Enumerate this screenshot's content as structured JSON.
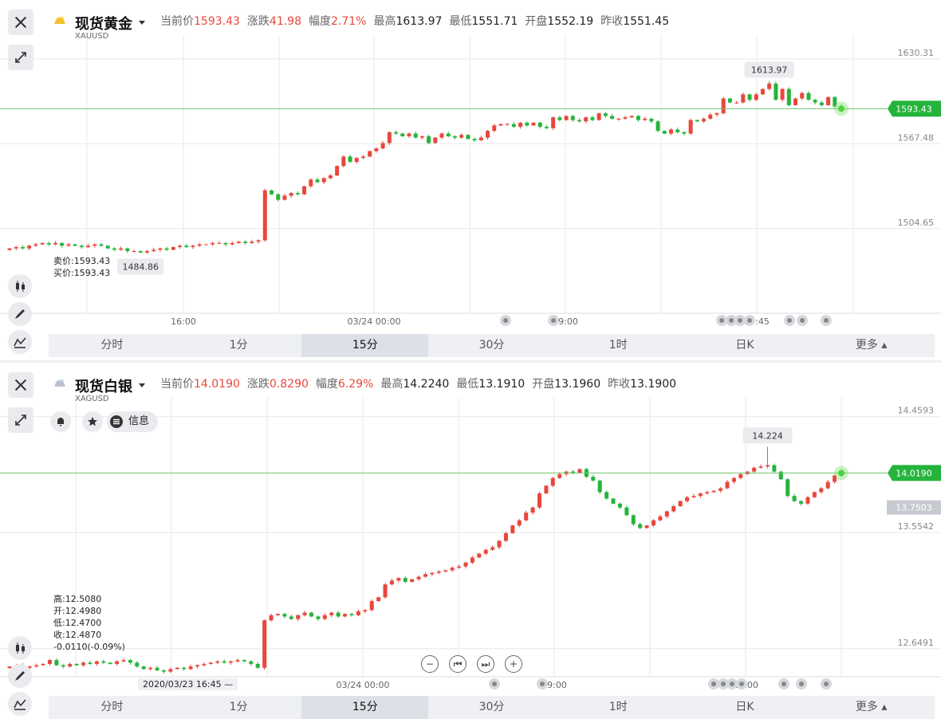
{
  "panels": [
    {
      "name": "现货黄金",
      "code": "XAUUSD",
      "quotes": [
        {
          "label": "当前价",
          "value": "1593.43",
          "up": true
        },
        {
          "label": "涨跌",
          "value": "41.98",
          "up": true
        },
        {
          "label": "幅度",
          "value": "2.71%",
          "up": true
        },
        {
          "label": "最高",
          "value": "1613.97",
          "up": false
        },
        {
          "label": "最低",
          "value": "1551.71",
          "up": false
        },
        {
          "label": "开盘",
          "value": "1552.19",
          "up": false
        },
        {
          "label": "昨收",
          "value": "1551.45",
          "up": false
        }
      ],
      "info": [
        "卖价:1593.43",
        "买价:1593.43"
      ]
    },
    {
      "name": "现货白银",
      "code": "XAGUSD",
      "quotes": [
        {
          "label": "当前价",
          "value": "14.0190",
          "up": true
        },
        {
          "label": "涨跌",
          "value": "0.8290",
          "up": true
        },
        {
          "label": "幅度",
          "value": "6.29%",
          "up": true
        },
        {
          "label": "最高",
          "value": "14.2240",
          "up": false
        },
        {
          "label": "最低",
          "value": "13.1910",
          "up": false
        },
        {
          "label": "开盘",
          "value": "13.1960",
          "up": false
        },
        {
          "label": "昨收",
          "value": "13.1900",
          "up": false
        }
      ],
      "info": [
        "高:12.5080",
        "开:12.4980",
        "低:12.4700",
        "收:12.4870",
        "-0.0110(-0.09%)"
      ],
      "buttons": {
        "info": "信息"
      },
      "crosshair_time": "2020/03/23 16:45"
    }
  ],
  "tabs": [
    "分时",
    "1分",
    "15分",
    "30分",
    "1时",
    "日K",
    "更多"
  ],
  "active_tab": "15分",
  "colors": {
    "up": "#e8473c",
    "down": "#25b43b",
    "price_line": "#6bc46d",
    "grid": "#e8e8e8"
  },
  "chart_data": [
    {
      "type": "candlestick",
      "symbol": "XAUUSD",
      "interval": "15分",
      "ylim": [
        1442,
        1642
      ],
      "y_ticks": [
        "1630.31",
        "1567.48",
        "1504.65"
      ],
      "x_ticks": [
        "16:00",
        "03/24 00:00",
        "09:00",
        "17:45"
      ],
      "last_price": "1593.43",
      "high_label": "1613.97",
      "low_label": "1484.86",
      "close": [
        1490,
        1491,
        1490,
        1492,
        1493,
        1494,
        1493,
        1494,
        1492,
        1493,
        1492,
        1491,
        1492,
        1493,
        1492,
        1490,
        1489,
        1490,
        1488,
        1488,
        1487,
        1488,
        1489,
        1490,
        1489,
        1491,
        1492,
        1491,
        1492,
        1493,
        1493,
        1494,
        1494,
        1493,
        1494,
        1495,
        1494,
        1495,
        1496,
        1533,
        1530,
        1526,
        1529,
        1531,
        1530,
        1536,
        1541,
        1539,
        1542,
        1544,
        1551,
        1558,
        1554,
        1557,
        1558,
        1562,
        1564,
        1568,
        1576,
        1575,
        1573,
        1575,
        1572,
        1573,
        1568,
        1572,
        1575,
        1573,
        1572,
        1574,
        1571,
        1570,
        1572,
        1577,
        1581,
        1582,
        1582,
        1580,
        1583,
        1581,
        1583,
        1580,
        1579,
        1587,
        1585,
        1588,
        1585,
        1584,
        1587,
        1585,
        1590,
        1588,
        1586,
        1586,
        1587,
        1588,
        1585,
        1586,
        1584,
        1577,
        1575,
        1578,
        1576,
        1575,
        1585,
        1584,
        1586,
        1589,
        1590,
        1601,
        1598,
        1598,
        1604,
        1600,
        1604,
        1608,
        1612,
        1600,
        1608,
        1596,
        1601,
        1605,
        1600,
        1598,
        1596,
        1602,
        1595,
        1593.43
      ]
    },
    {
      "type": "candlestick",
      "symbol": "XAGUSD",
      "interval": "15分",
      "ylim": [
        12.43,
        14.55
      ],
      "y_ticks": [
        "14.4593",
        "13.5542",
        "12.6491"
      ],
      "x_ticks": [
        "03/24 00:00",
        "09:00",
        "17:00"
      ],
      "last_price": "14.0190",
      "current_level": "13.7503",
      "high_label": "14.224",
      "close": [
        12.51,
        12.52,
        12.5,
        12.51,
        12.52,
        12.53,
        12.56,
        12.52,
        12.51,
        12.53,
        12.52,
        12.54,
        12.53,
        12.55,
        12.54,
        12.53,
        12.55,
        12.56,
        12.54,
        12.51,
        12.49,
        12.5,
        12.48,
        12.47,
        12.49,
        12.5,
        12.49,
        12.51,
        12.52,
        12.53,
        12.54,
        12.55,
        12.54,
        12.55,
        12.56,
        12.55,
        12.53,
        12.5,
        12.87,
        12.91,
        12.92,
        12.9,
        12.88,
        12.91,
        12.93,
        12.9,
        12.88,
        12.91,
        12.93,
        12.9,
        12.92,
        12.91,
        12.94,
        12.95,
        13.02,
        13.05,
        13.15,
        13.18,
        13.2,
        13.17,
        13.19,
        13.21,
        13.23,
        13.24,
        13.25,
        13.26,
        13.28,
        13.29,
        13.32,
        13.36,
        13.39,
        13.42,
        13.44,
        13.49,
        13.55,
        13.61,
        13.65,
        13.71,
        13.75,
        13.86,
        13.92,
        13.98,
        14.01,
        14.03,
        14.02,
        14.05,
        13.99,
        13.96,
        13.87,
        13.82,
        13.78,
        13.75,
        13.69,
        13.62,
        13.59,
        13.61,
        13.65,
        13.68,
        13.72,
        13.76,
        13.8,
        13.83,
        13.84,
        13.86,
        13.87,
        13.88,
        13.9,
        13.95,
        13.98,
        14.01,
        14.03,
        14.06,
        14.07,
        14.08,
        14.03,
        13.97,
        13.84,
        13.8,
        13.78,
        13.83,
        13.87,
        13.9,
        13.95,
        14.0,
        14.019
      ]
    }
  ]
}
